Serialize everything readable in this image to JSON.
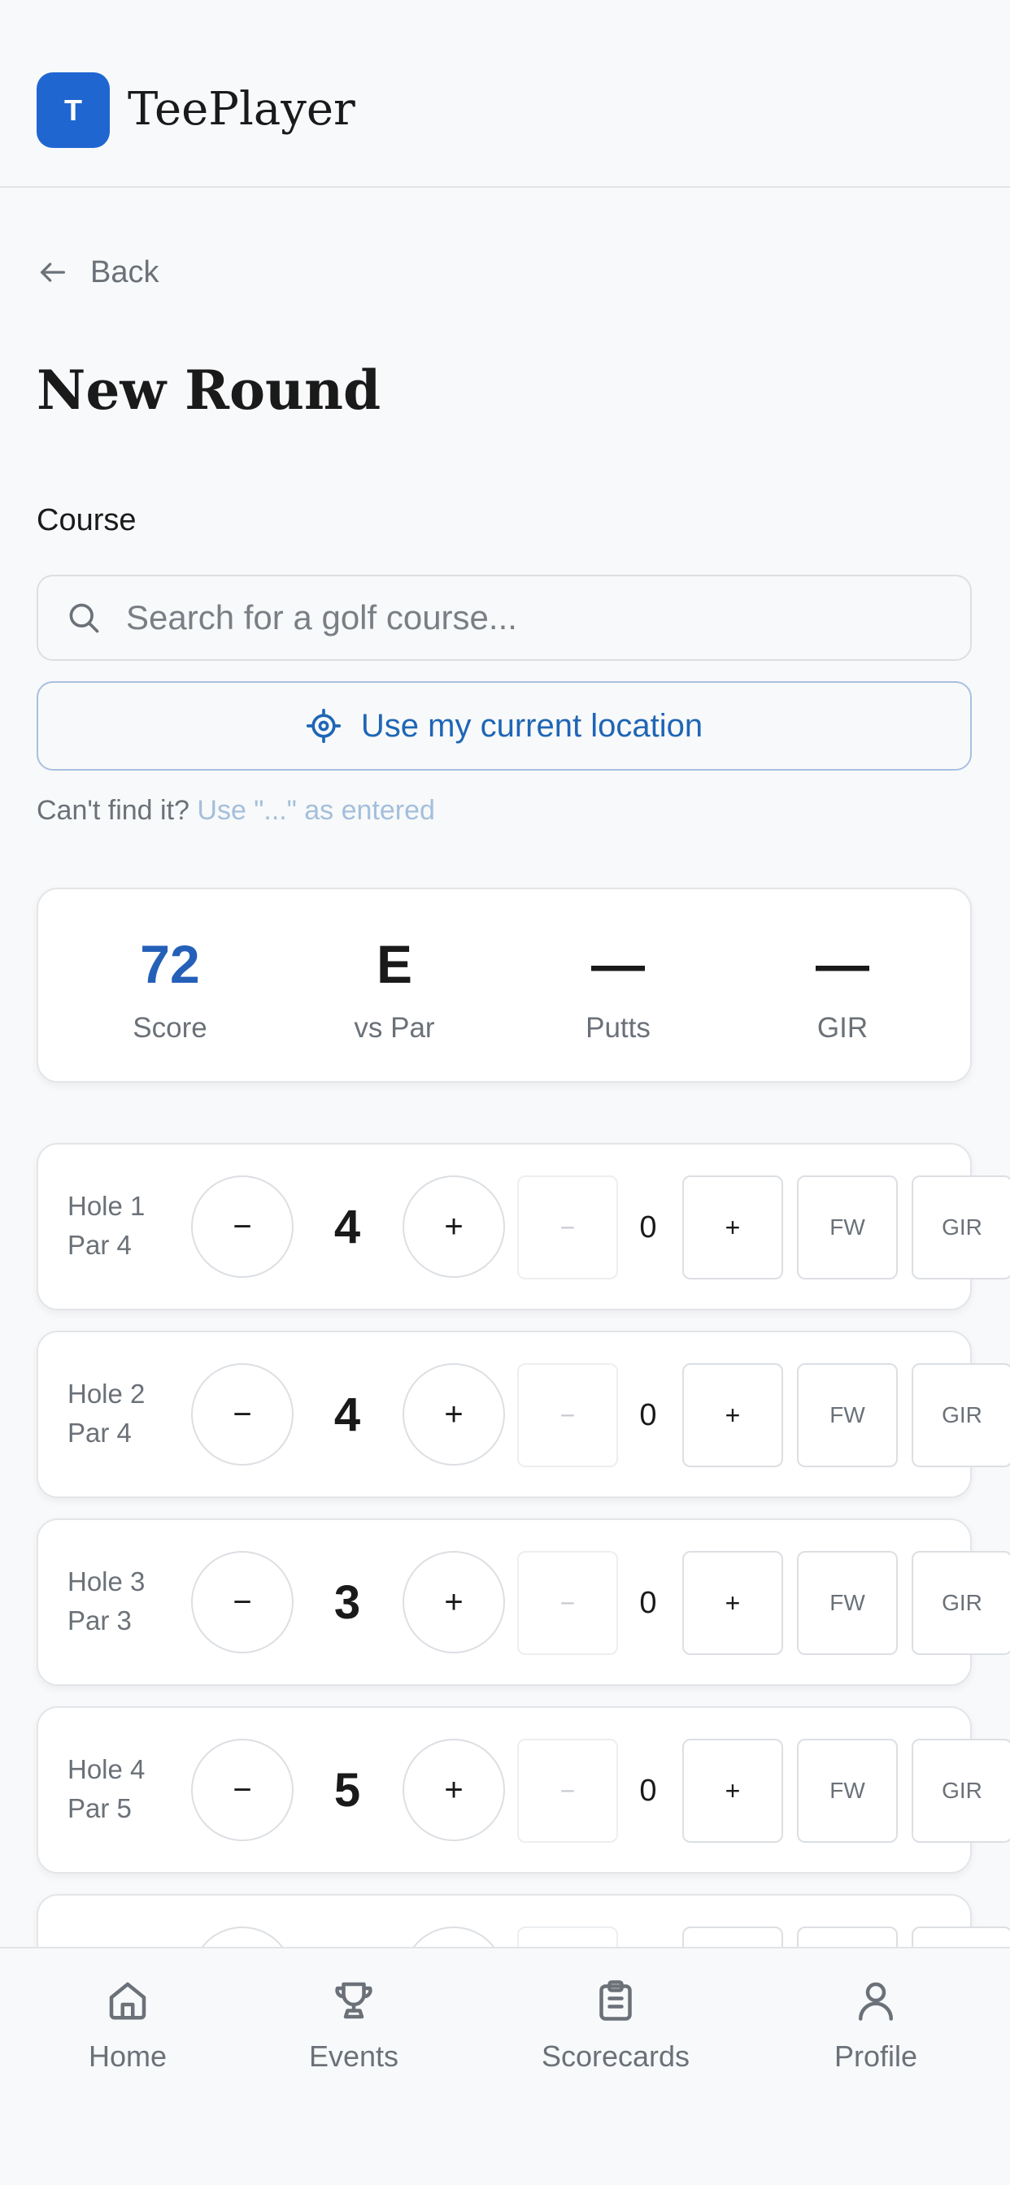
{
  "header": {
    "logo_letter": "T",
    "app_name": "TeePlayer"
  },
  "back_label": "Back",
  "page_title": "New Round",
  "course": {
    "label": "Course",
    "search_placeholder": "Search for a golf course...",
    "location_button": "Use my current location",
    "cant_find_text": "Can't find it?",
    "cant_find_link": "Use \"...\" as entered"
  },
  "summary": [
    {
      "value": "72",
      "label": "Score"
    },
    {
      "value": "E",
      "label": "vs Par"
    },
    {
      "value": "—",
      "label": "Putts"
    },
    {
      "value": "—",
      "label": "GIR"
    }
  ],
  "controls": {
    "minus": "−",
    "plus": "+",
    "fw": "FW",
    "gir": "GIR"
  },
  "holes": [
    {
      "hole": "Hole 1",
      "par": "Par 4",
      "strokes": "4",
      "putts": "0"
    },
    {
      "hole": "Hole 2",
      "par": "Par 4",
      "strokes": "4",
      "putts": "0"
    },
    {
      "hole": "Hole 3",
      "par": "Par 3",
      "strokes": "3",
      "putts": "0"
    },
    {
      "hole": "Hole 4",
      "par": "Par 5",
      "strokes": "5",
      "putts": "0"
    }
  ],
  "nav": [
    {
      "label": "Home",
      "icon": "home-icon"
    },
    {
      "label": "Events",
      "icon": "trophy-icon"
    },
    {
      "label": "Scorecards",
      "icon": "clipboard-icon"
    },
    {
      "label": "Profile",
      "icon": "user-icon"
    }
  ],
  "colors": {
    "brand": "#1f66d1",
    "accent_text": "#2460b8",
    "link_muted": "#a3bfdc"
  }
}
